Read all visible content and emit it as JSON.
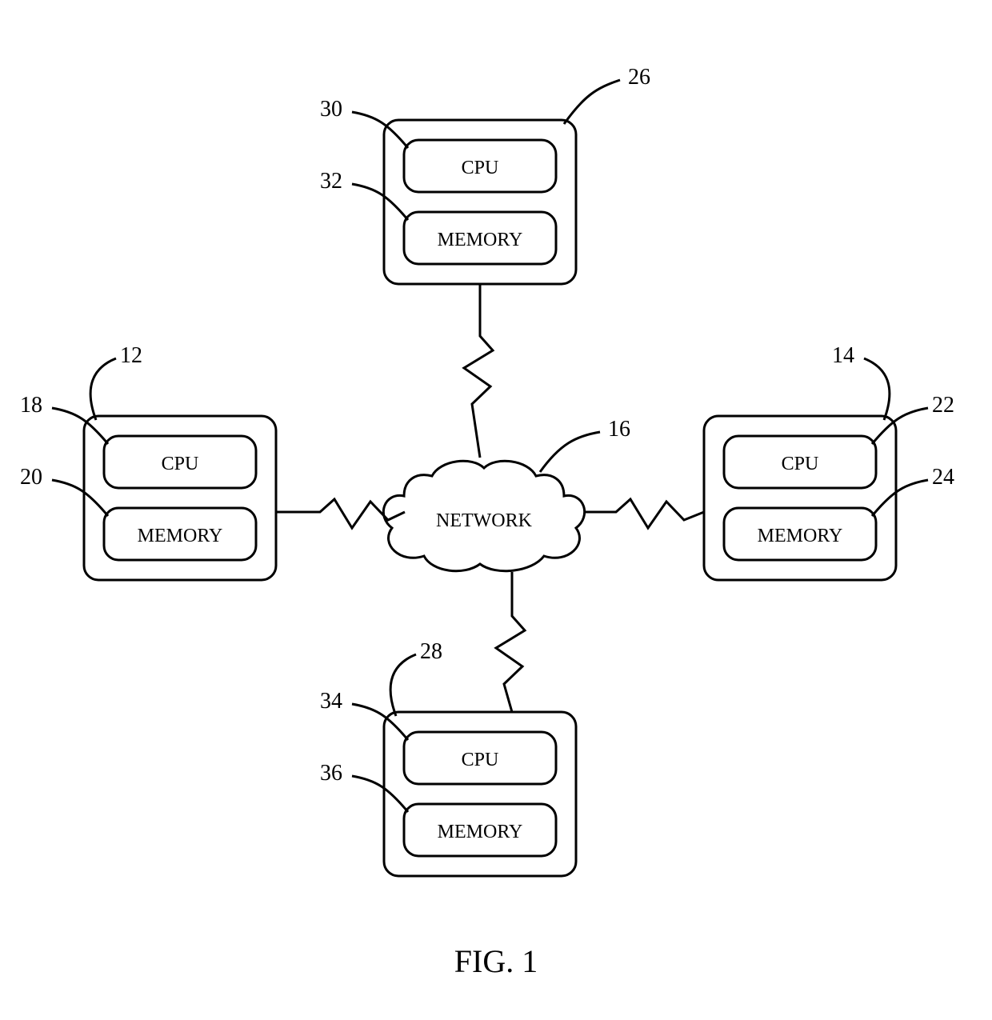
{
  "caption": "FIG. 1",
  "network_label": "NETWORK",
  "nodes": {
    "top": {
      "ref_outer": "26",
      "ref_cpu": "30",
      "ref_mem": "32",
      "cpu": "CPU",
      "mem": "MEMORY"
    },
    "left": {
      "ref_outer": "12",
      "ref_cpu": "18",
      "ref_mem": "20",
      "cpu": "CPU",
      "mem": "MEMORY"
    },
    "right": {
      "ref_outer": "14",
      "ref_cpu": "22",
      "ref_mem": "24",
      "cpu": "CPU",
      "mem": "MEMORY"
    },
    "bottom": {
      "ref_outer": "28",
      "ref_cpu": "34",
      "ref_mem": "36",
      "cpu": "CPU",
      "mem": "MEMORY"
    }
  },
  "network_ref": "16"
}
